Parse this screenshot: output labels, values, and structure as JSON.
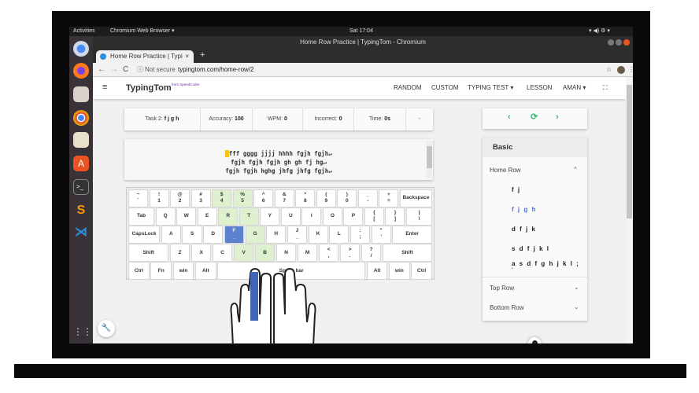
{
  "os": {
    "activities": "Activities",
    "app_menu": "Chromium Web Browser ▾",
    "clock": "Sat 17:04",
    "tray": "▾ ◀) ⚙ ▾"
  },
  "browser": {
    "window_title": "Home Row Practice | TypingTom - Chromium",
    "tab_title": "Home Row Practice | Typi",
    "tab_close": "×",
    "new_tab": "+",
    "not_secure": "Not secure",
    "url": "typingtom.com/home-row/2"
  },
  "app": {
    "brand": "TypingTom",
    "brand_sub": "from SpeedCoder",
    "nav": [
      "RANDOM",
      "CUSTOM",
      "TYPING TEST ▾",
      "LESSON",
      "AMAN ▾"
    ]
  },
  "stats": {
    "task_label": "Task 2:",
    "task_value": "f j g h",
    "accuracy_label": "Accuracy:",
    "accuracy_value": "100",
    "wpm_label": "WPM:",
    "wpm_value": "0",
    "incorrect_label": "Incorrect:",
    "incorrect_value": "0",
    "time_label": "Time:",
    "time_value": "0s",
    "more": "-"
  },
  "text": {
    "cursor": "f",
    "line1": "fff gggg jjjj hhhh fgjh fgjh↵",
    "line2": "fgjh fgjh fgjh gh gh fj hg↵",
    "line3": "fgjh fgjh hghg jhfg jhfg fgjh↵"
  },
  "keyboard": [
    [
      {
        "t": "~",
        "b": "`"
      },
      {
        "t": "!",
        "b": "1"
      },
      {
        "t": "@",
        "b": "2"
      },
      {
        "t": "#",
        "b": "3"
      },
      {
        "t": "$",
        "b": "4",
        "h": "green"
      },
      {
        "t": "%",
        "b": "5",
        "h": "green"
      },
      {
        "t": "^",
        "b": "6"
      },
      {
        "t": "&",
        "b": "7"
      },
      {
        "t": "*",
        "b": "8"
      },
      {
        "t": "(",
        "b": "9"
      },
      {
        "t": ")",
        "b": "0"
      },
      {
        "t": "_",
        "b": "-"
      },
      {
        "t": "+",
        "b": "="
      },
      {
        "t": "Backspace",
        "w": 1.7
      }
    ],
    [
      {
        "t": "Tab",
        "w": 1.35
      },
      {
        "t": "Q"
      },
      {
        "t": "W"
      },
      {
        "t": "E"
      },
      {
        "t": "R",
        "h": "green"
      },
      {
        "t": "T",
        "h": "green"
      },
      {
        "t": "Y"
      },
      {
        "t": "U"
      },
      {
        "t": "I"
      },
      {
        "t": "O"
      },
      {
        "t": "P"
      },
      {
        "t": "{",
        "b": "["
      },
      {
        "t": "}",
        "b": "]"
      },
      {
        "t": "|",
        "b": "\\",
        "w": 1.35
      }
    ],
    [
      {
        "t": "CapsLock",
        "w": 1.65
      },
      {
        "t": "A"
      },
      {
        "t": "S"
      },
      {
        "t": "D"
      },
      {
        "t": "F",
        "b": "_",
        "h": "blue"
      },
      {
        "t": "G",
        "h": "green"
      },
      {
        "t": "H"
      },
      {
        "t": "J",
        "b": "_"
      },
      {
        "t": "K"
      },
      {
        "t": "L"
      },
      {
        "t": ":",
        "b": ";"
      },
      {
        "t": "\"",
        "b": "'"
      },
      {
        "t": "Enter",
        "w": 2.1
      }
    ],
    [
      {
        "t": "Shift",
        "w": 2.1
      },
      {
        "t": "Z"
      },
      {
        "t": "X"
      },
      {
        "t": "C"
      },
      {
        "t": "V",
        "h": "green"
      },
      {
        "t": "B",
        "h": "green"
      },
      {
        "t": "N"
      },
      {
        "t": "M"
      },
      {
        "t": "<",
        "b": ","
      },
      {
        "t": ">",
        "b": "."
      },
      {
        "t": "?",
        "b": "/"
      },
      {
        "t": "Shift",
        "w": 2.6
      }
    ],
    [
      {
        "t": "Ctrl"
      },
      {
        "t": "Fn"
      },
      {
        "t": "win"
      },
      {
        "t": "Alt"
      },
      {
        "t": "Space bar",
        "w": 7.5
      },
      {
        "t": "Alt"
      },
      {
        "t": "win"
      },
      {
        "t": "Ctrl"
      }
    ]
  ],
  "sidebar": {
    "title": "Basic",
    "section": "Home Row",
    "items": [
      "f j",
      "f j g h",
      "d f j k",
      "s d f j k l",
      "a s d f g h j k l ;"
    ],
    "extra": "'",
    "active_index": 1,
    "collapsed": [
      "Top Row",
      "Bottom Row"
    ]
  },
  "colors": {
    "accent": "#4a6fd1",
    "green": "#2eb872",
    "highlight": "#f5c518"
  }
}
